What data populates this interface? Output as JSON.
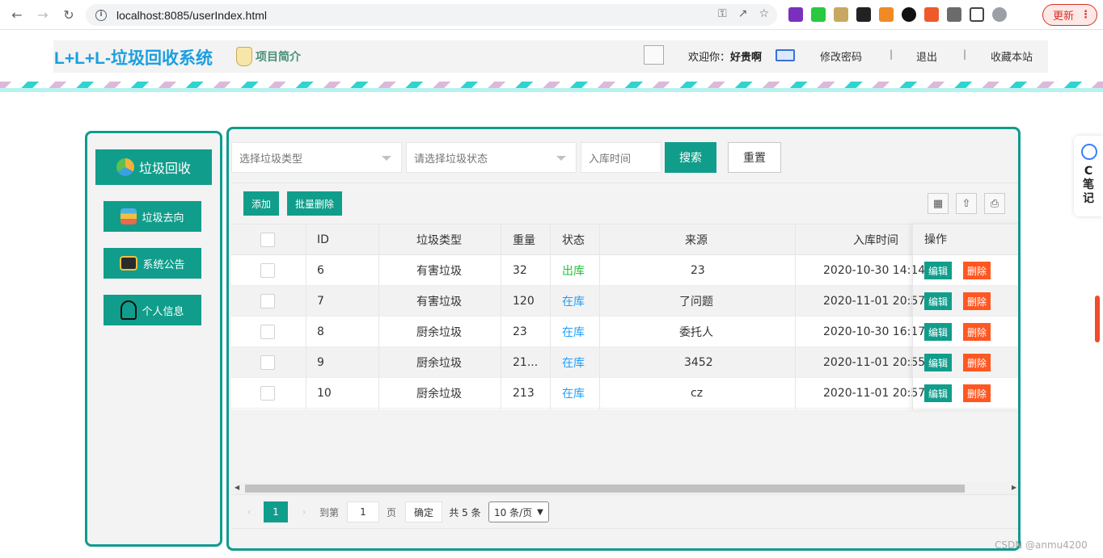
{
  "browser": {
    "url": "localhost:8085/userIndex.html",
    "update_label": "更新"
  },
  "header": {
    "logo": "L+L+L-垃圾回收系统",
    "project_intro": "项目简介",
    "welcome_prefix": "欢迎你：",
    "username": "好贵啊",
    "change_password": "修改密码",
    "separator": "|",
    "logout": "退出",
    "bookmark": "收藏本站"
  },
  "sidebar": {
    "items": [
      {
        "label": "垃圾回收",
        "icon": "recycle-icon"
      },
      {
        "label": "垃圾去向",
        "icon": "signpost-icon"
      },
      {
        "label": "系统公告",
        "icon": "briefcase-icon"
      },
      {
        "label": "个人信息",
        "icon": "user-icon"
      }
    ]
  },
  "search": {
    "type_placeholder": "选择垃圾类型",
    "status_placeholder": "请选择垃圾状态",
    "time_placeholder": "入库时间",
    "search_label": "搜索",
    "reset_label": "重置"
  },
  "toolbar": {
    "add_label": "添加",
    "batch_delete_label": "批量删除"
  },
  "table": {
    "columns": [
      "ID",
      "垃圾类型",
      "重量",
      "状态",
      "来源",
      "入库时间",
      "操作"
    ],
    "rows": [
      {
        "id": "6",
        "type": "有害垃圾",
        "weight": "32",
        "status": "出库",
        "source": "23",
        "time": "2020-10-30 14:14"
      },
      {
        "id": "7",
        "type": "有害垃圾",
        "weight": "120",
        "status": "在库",
        "source": "了问题",
        "time": "2020-11-01 20:57"
      },
      {
        "id": "8",
        "type": "厨余垃圾",
        "weight": "23",
        "status": "在库",
        "source": "委托人",
        "time": "2020-10-30 16:17"
      },
      {
        "id": "9",
        "type": "厨余垃圾",
        "weight": "21...",
        "status": "在库",
        "source": "3452",
        "time": "2020-11-01 20:55"
      },
      {
        "id": "10",
        "type": "厨余垃圾",
        "weight": "213",
        "status": "在库",
        "source": "cz",
        "time": "2020-11-01 20:57"
      }
    ],
    "edit_label": "编辑",
    "delete_label": "删除"
  },
  "pager": {
    "current_page": "1",
    "goto_prefix": "到第",
    "goto_value": "1",
    "page_suffix": "页",
    "confirm_label": "确定",
    "total": "共 5 条",
    "page_size": "10 条/页"
  },
  "float_note": {
    "label": "C\n笔\n记"
  },
  "watermark": "CSDN @anmu4200",
  "colors": {
    "accent": "#119d8b",
    "danger": "#ff5722",
    "status_out": "#23c23a",
    "status_in": "#1e9fff"
  }
}
